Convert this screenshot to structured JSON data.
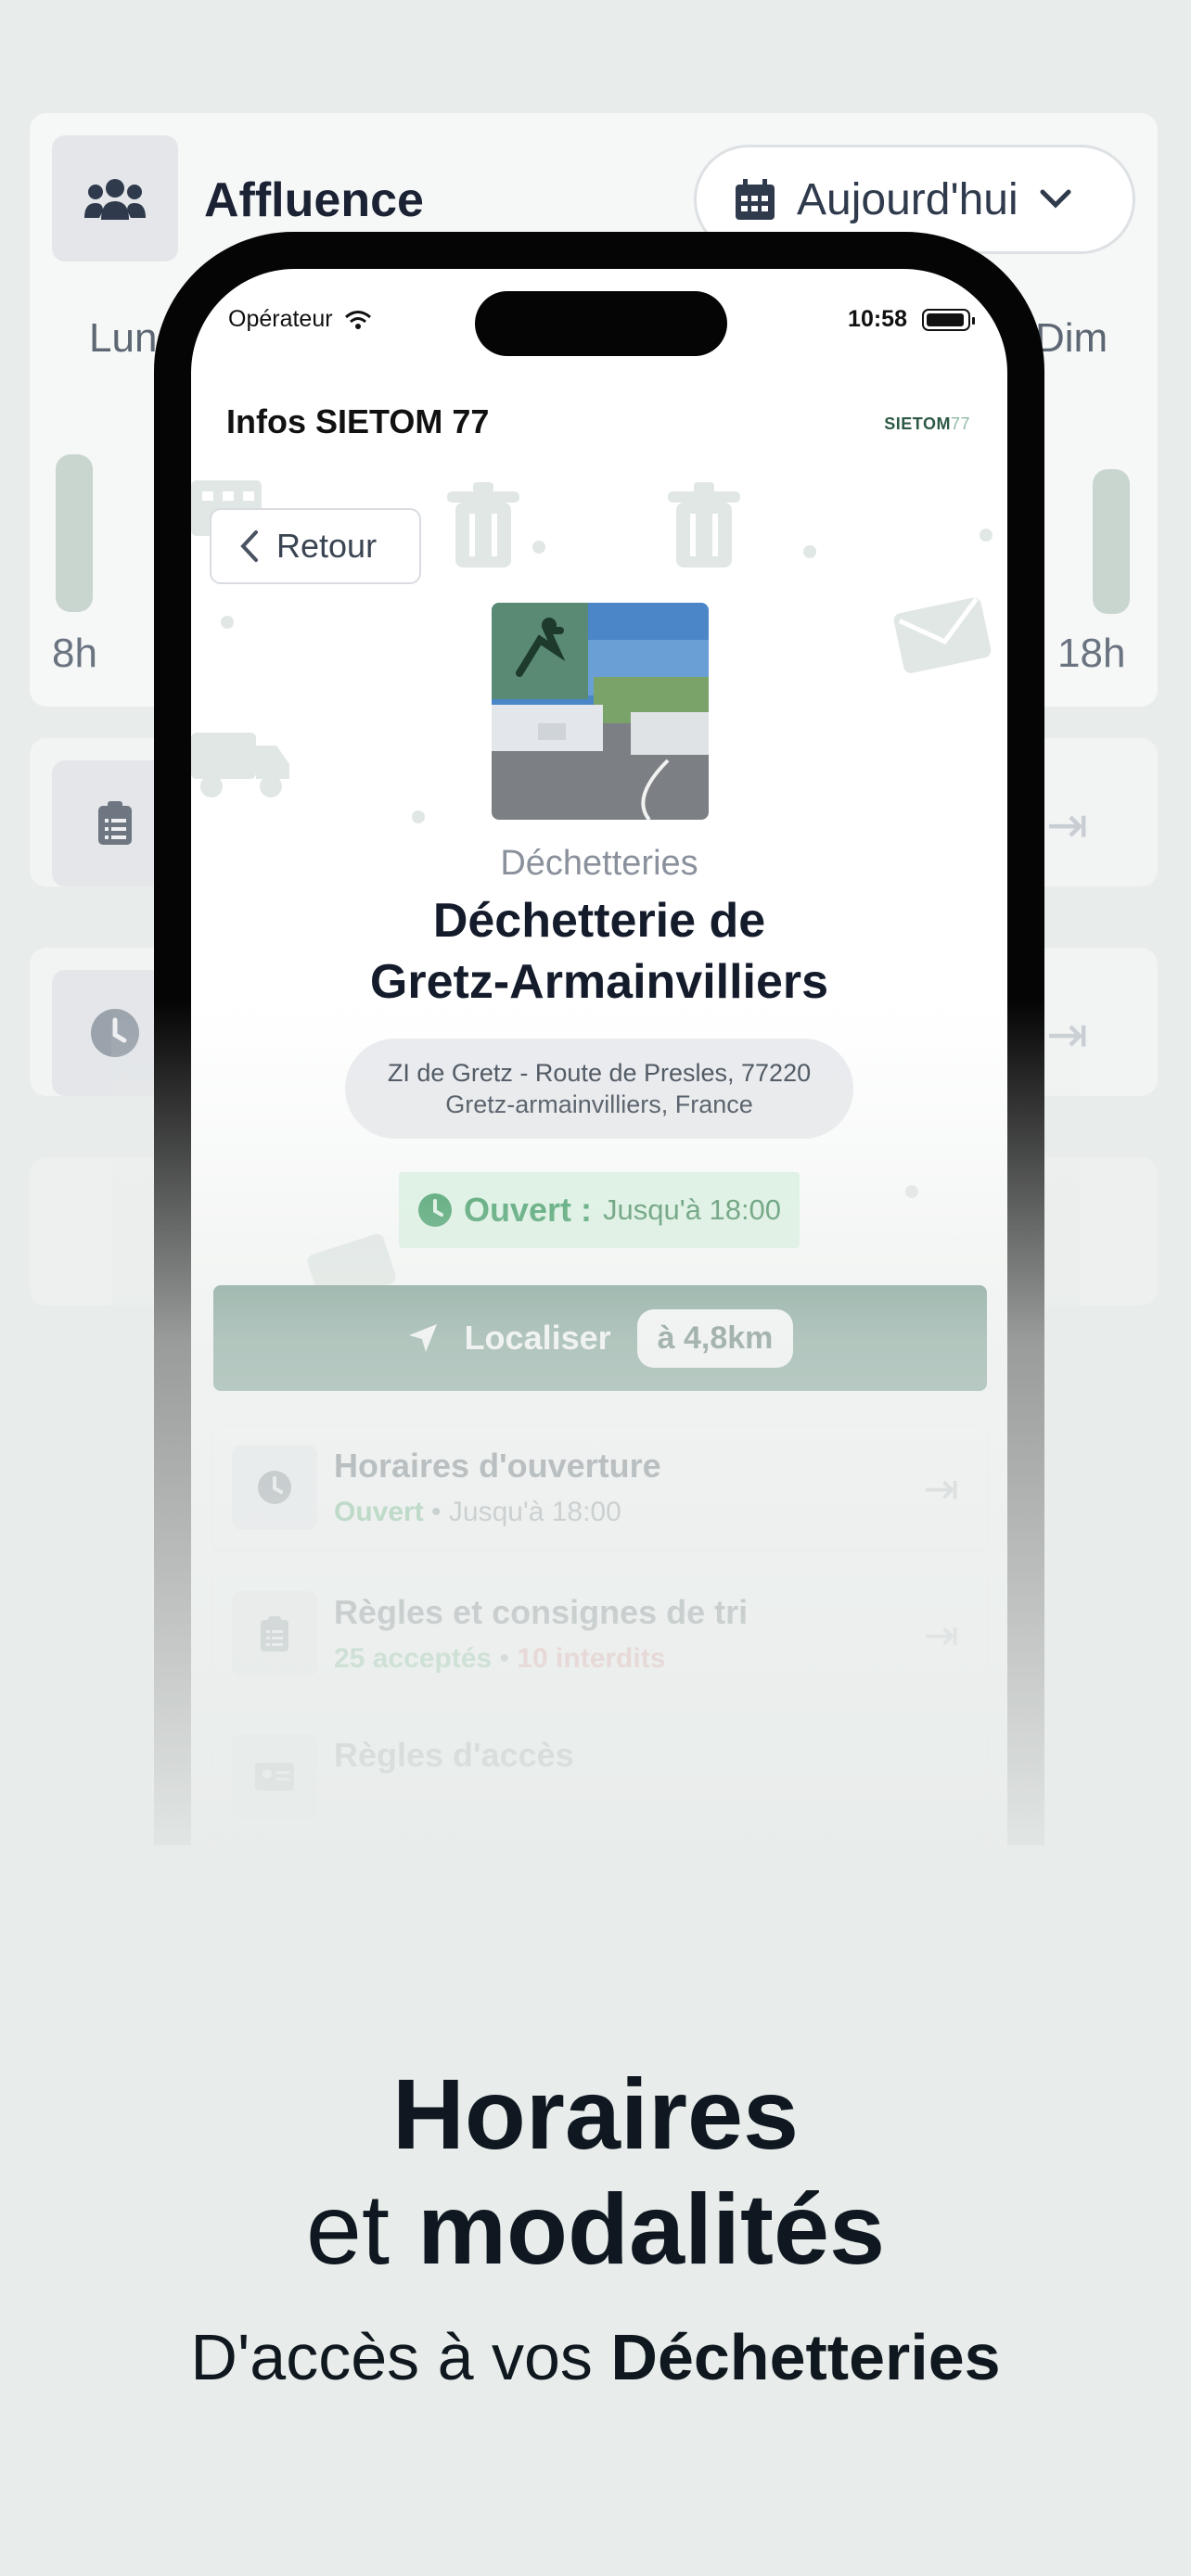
{
  "background": {
    "title": "Affluence",
    "date_selector": "Aujourd'hui",
    "days": [
      "Lun",
      "Dim"
    ],
    "hours": [
      "8h",
      "18h"
    ]
  },
  "status_bar": {
    "carrier": "Opérateur",
    "time": "10:58"
  },
  "header": {
    "title": "Infos SIETOM 77",
    "logo_text": "SIETOM",
    "logo_suffix": "77"
  },
  "back_button": "Retour",
  "place": {
    "category": "Déchetteries",
    "title_line1": "Déchetterie de",
    "title_line2": "Gretz-Armainvilliers",
    "address_line1": "ZI de Gretz - Route de Presles, 77220",
    "address_line2": "Gretz-armainvilliers, France"
  },
  "open_status": {
    "label": "Ouvert :",
    "value": "Jusqu'à 18:00"
  },
  "locate": {
    "label": "Localiser",
    "distance": "à 4,8km"
  },
  "info_rows": [
    {
      "title": "Horaires d'ouverture",
      "status": "Ouvert",
      "sep": "•",
      "detail": "Jusqu'à 18:00"
    },
    {
      "title": "Règles et consignes de tri",
      "accepted": "25 acceptés",
      "sep": "•",
      "forbidden": "10 interdits"
    },
    {
      "title": "Règles d'accès"
    }
  ],
  "marketing": {
    "headline_line1": "Horaires",
    "headline_line2_regular": "et",
    "headline_line2_bold": "modalités",
    "subline_regular": "D'accès à vos",
    "subline_bold": "Déchetteries"
  },
  "colors": {
    "accent": "#4c7d6b",
    "open_green": "#1f8e4c",
    "forbidden_red": "#e06b6b"
  }
}
